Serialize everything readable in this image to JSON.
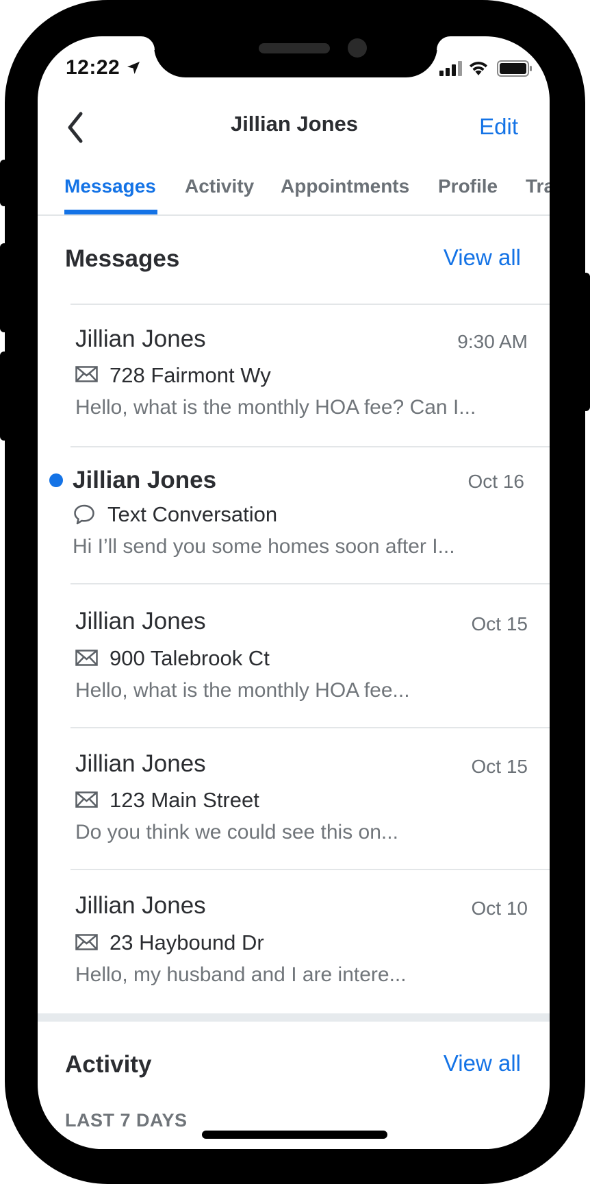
{
  "status_bar": {
    "time": "12:22"
  },
  "header": {
    "title": "Jillian Jones",
    "edit_label": "Edit"
  },
  "tabs": [
    {
      "label": "Messages",
      "active": true
    },
    {
      "label": "Activity"
    },
    {
      "label": "Appointments"
    },
    {
      "label": "Profile"
    },
    {
      "label": "Transactions"
    }
  ],
  "messages_section": {
    "title": "Messages",
    "view_all_label": "View all",
    "items": [
      {
        "name": "Jillian Jones",
        "time": "9:30 AM",
        "icon": "envelope-icon",
        "subject": "728 Fairmont Wy",
        "preview": "Hello, what is the monthly HOA fee? Can I...",
        "unread": false
      },
      {
        "name": "Jillian Jones",
        "time": "Oct 16",
        "icon": "chat-bubble-icon",
        "subject": "Text Conversation",
        "preview": "Hi I’ll send you some homes soon after I...",
        "unread": true
      },
      {
        "name": "Jillian Jones",
        "time": "Oct 15",
        "icon": "envelope-icon",
        "subject": "900 Talebrook Ct",
        "preview": "Hello, what is the monthly HOA fee...",
        "unread": false
      },
      {
        "name": "Jillian Jones",
        "time": "Oct 15",
        "icon": "envelope-icon",
        "subject": "123 Main Street",
        "preview": "Do you think we could see this on...",
        "unread": false
      },
      {
        "name": "Jillian Jones",
        "time": "Oct 10",
        "icon": "envelope-icon",
        "subject": "23 Haybound Dr",
        "preview": "Hello, my husband and I are intere...",
        "unread": false
      }
    ]
  },
  "activity_section": {
    "title": "Activity",
    "view_all_label": "View all",
    "period_label": "LAST 7 DAYS"
  },
  "colors": {
    "accent": "#1473e6",
    "text": "#2b2d31",
    "secondary": "#6b7177",
    "divider": "#e3e6e8"
  }
}
